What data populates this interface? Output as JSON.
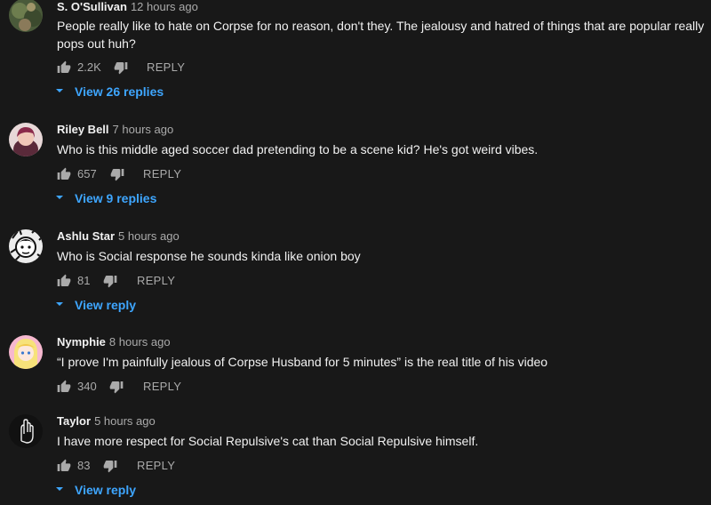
{
  "comments": [
    {
      "author": "S. O'Sullivan",
      "time": "12 hours ago",
      "text": "People really like to hate on Corpse for no reason, don't they. The jealousy and hatred of things that are popular really pops out huh?",
      "likes": "2.2K",
      "reply_label": "REPLY",
      "view_replies": "View 26 replies",
      "avatar": "nature-photo-avatar"
    },
    {
      "author": "Riley Bell",
      "time": "7 hours ago",
      "text": "Who is this middle aged soccer dad pretending to be a scene kid? He's got weird vibes.",
      "likes": "657",
      "reply_label": "REPLY",
      "view_replies": "View 9 replies",
      "avatar": "person-photo-avatar"
    },
    {
      "author": "Ashlu Star",
      "time": "5 hours ago",
      "text": "Who is Social response he sounds kinda like onion boy",
      "likes": "81",
      "reply_label": "REPLY",
      "view_replies": "View reply",
      "avatar": "drawing-avatar"
    },
    {
      "author": "Nymphie",
      "time": "8 hours ago",
      "text": "“I prove I'm painfully jealous of Corpse Husband for 5 minutes” is the real title of his video",
      "likes": "340",
      "reply_label": "REPLY",
      "avatar": "anime-avatar"
    },
    {
      "author": "Taylor",
      "time": "5 hours ago",
      "text": "I have more respect for Social Repulsive's cat than Social Repulsive himself.",
      "likes": "83",
      "reply_label": "REPLY",
      "view_replies": "View reply",
      "avatar": "hand-sketch-avatar"
    }
  ],
  "colors": {
    "background": "#181818",
    "text": "#f1f1f1",
    "muted": "#aaaaaa",
    "link": "#3ea6ff"
  }
}
